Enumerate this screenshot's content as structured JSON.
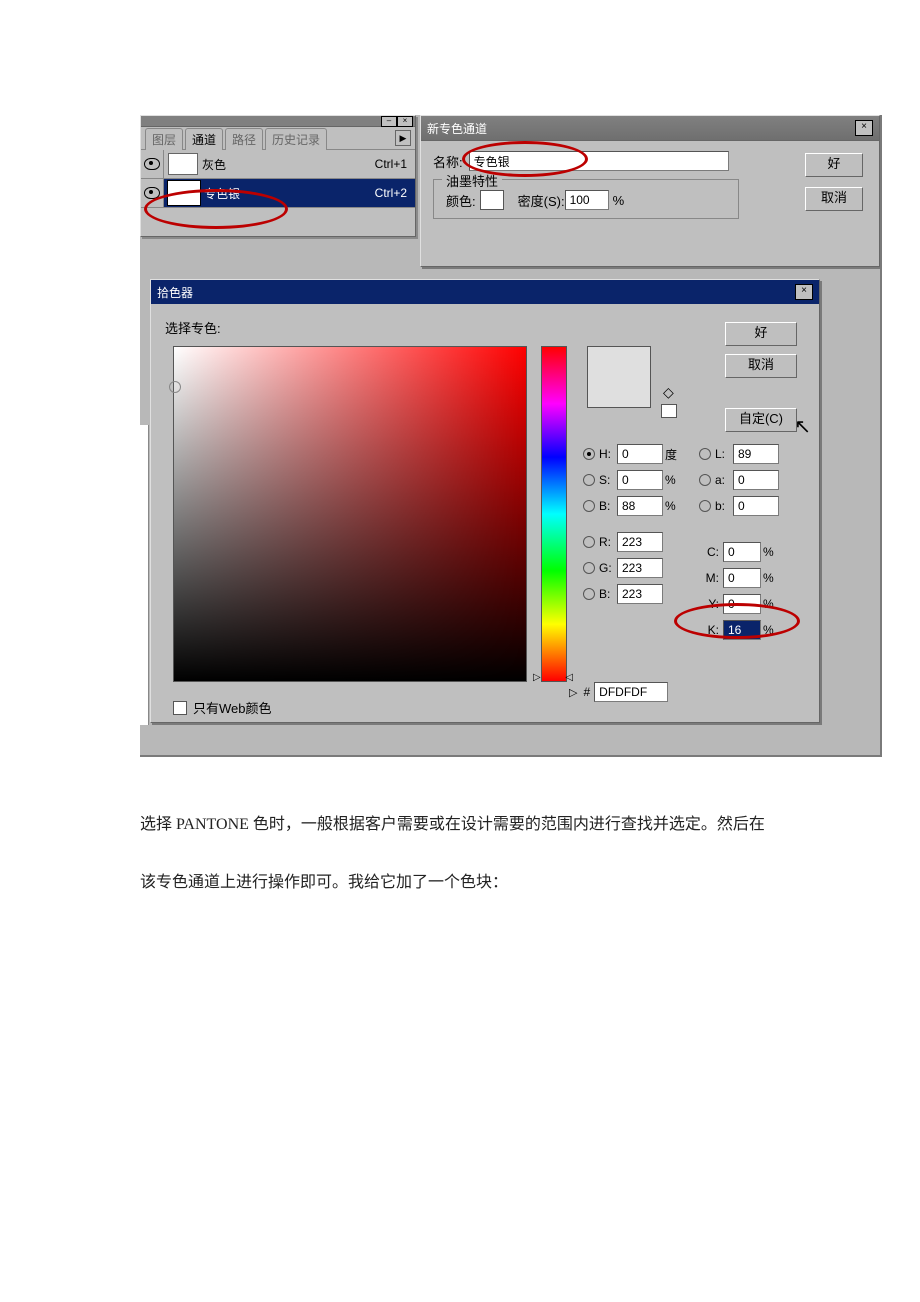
{
  "channels_palette": {
    "tabs": [
      "图层",
      "通道",
      "路径",
      "历史记录"
    ],
    "rows": [
      {
        "name": "灰色",
        "shortcut": "Ctrl+1",
        "selected": false
      },
      {
        "name": "专色银",
        "shortcut": "Ctrl+2",
        "selected": true
      }
    ]
  },
  "spot_dialog": {
    "title": "新专色通道",
    "name_label": "名称:",
    "name_value": "专色银",
    "group_title": "油墨特性",
    "color_label": "颜色:",
    "density_label": "密度(S):",
    "density_value": "100",
    "density_unit": "%",
    "ok": "好",
    "cancel": "取消"
  },
  "picker": {
    "title": "拾色器",
    "select_label": "选择专色:",
    "ok": "好",
    "cancel": "取消",
    "custom": "自定(C)",
    "web_only": "只有Web颜色",
    "hex_prefix": "#",
    "hex_value": "DFDFDF",
    "hsb": {
      "H": {
        "value": "0",
        "unit": "度",
        "selected": true
      },
      "S": {
        "value": "0",
        "unit": "%",
        "selected": false
      },
      "B": {
        "value": "88",
        "unit": "%",
        "selected": false
      }
    },
    "lab": {
      "L": {
        "value": "89",
        "selected": false
      },
      "a": {
        "value": "0",
        "selected": false
      },
      "b": {
        "value": "0",
        "selected": false
      }
    },
    "rgb": {
      "R": {
        "value": "223",
        "selected": false
      },
      "G": {
        "value": "223",
        "selected": false
      },
      "B": {
        "value": "223",
        "selected": false
      }
    },
    "cmyk": {
      "C": {
        "value": "0",
        "unit": "%"
      },
      "M": {
        "value": "0",
        "unit": "%"
      },
      "Y": {
        "value": "0",
        "unit": "%"
      },
      "K": {
        "value": "16",
        "unit": "%"
      }
    }
  },
  "article": {
    "p1": "选择 PANTONE 色时，一般根据客户需要或在设计需要的范围内进行查找并选定。然后在",
    "p2": "该专色通道上进行操作即可。我给它加了一个色块："
  }
}
